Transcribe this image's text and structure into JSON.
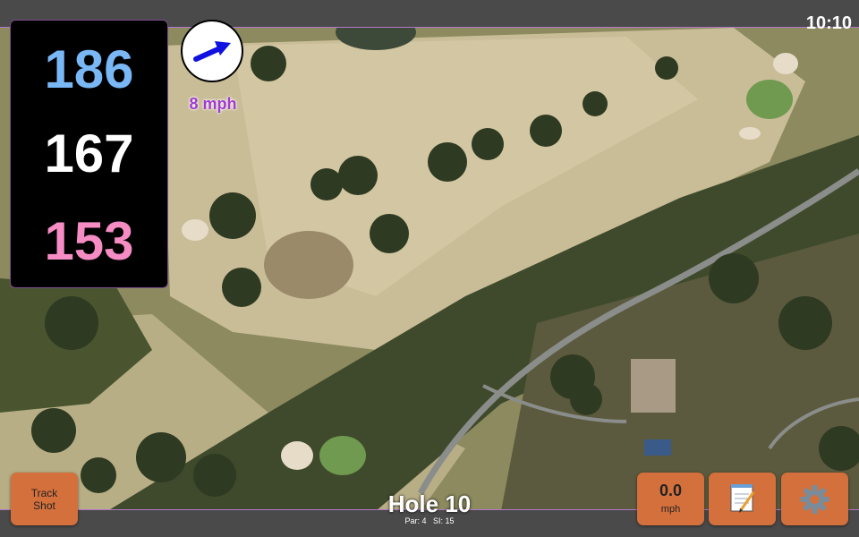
{
  "status": {
    "time": "10:10"
  },
  "distances": {
    "back": "186",
    "middle": "167",
    "front": "153"
  },
  "wind": {
    "speed_label": "8 mph",
    "icon": "arrow-icon",
    "arrow_color": "#1010e0"
  },
  "buttons": {
    "track_shot_line1": "Track",
    "track_shot_line2": "Shot",
    "speed_value": "0.0",
    "speed_unit": "mph",
    "notes_icon": "notepad-icon",
    "settings_icon": "gear-icon"
  },
  "hole": {
    "title": "Hole 10",
    "par": "Par: 4",
    "si": "SI: 15"
  },
  "colors": {
    "button": "#d4703c",
    "back_distance": "#7ab8f5",
    "middle_distance": "#ffffff",
    "front_distance": "#f58cc4",
    "wind_label": "#a13ad0",
    "accent_border": "#b277c9"
  }
}
